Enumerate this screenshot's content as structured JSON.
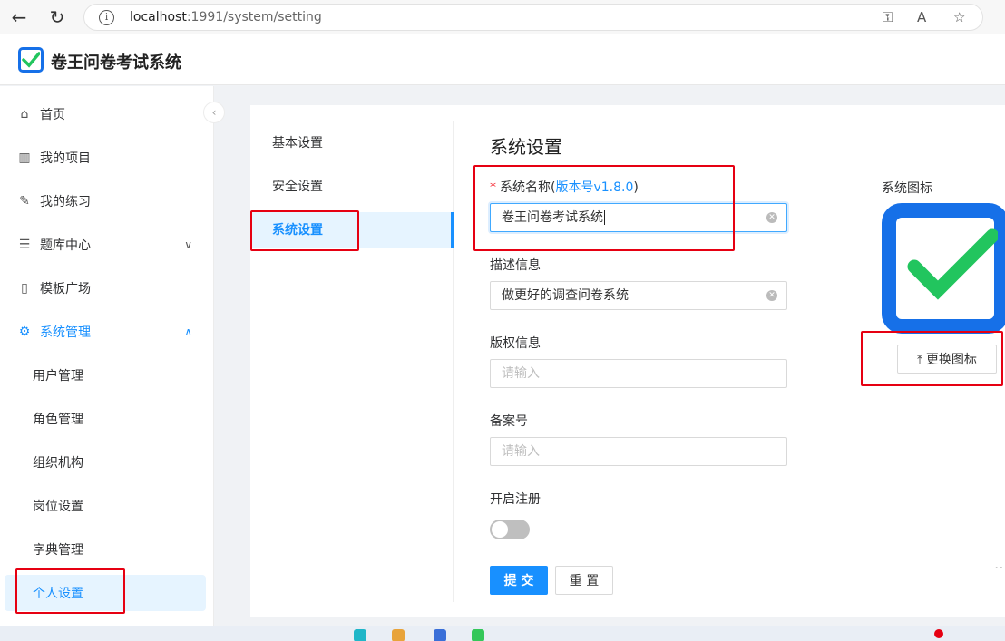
{
  "browser": {
    "url_host": "localhost",
    "url_rest": ":1991/system/setting"
  },
  "app": {
    "title": "卷王问卷考试系统"
  },
  "sidebar": {
    "items": [
      {
        "label": "首页",
        "icon": "home-icon"
      },
      {
        "label": "我的项目",
        "icon": "project-icon"
      },
      {
        "label": "我的练习",
        "icon": "edit-icon"
      },
      {
        "label": "题库中心",
        "icon": "database-icon"
      },
      {
        "label": "模板广场",
        "icon": "template-icon"
      },
      {
        "label": "系统管理",
        "icon": "gear-icon"
      },
      {
        "label": "用户管理"
      },
      {
        "label": "角色管理"
      },
      {
        "label": "组织机构"
      },
      {
        "label": "岗位设置"
      },
      {
        "label": "字典管理"
      },
      {
        "label": "个人设置"
      }
    ]
  },
  "tabs": [
    {
      "label": "基本设置"
    },
    {
      "label": "安全设置"
    },
    {
      "label": "系统设置"
    }
  ],
  "form": {
    "title": "系统设置",
    "name_label": "系统名称(",
    "name_version": "版本号v1.8.0",
    "name_label_end": ")",
    "name_value": "卷王问卷考试系统",
    "desc_label": "描述信息",
    "desc_value": "做更好的调查问卷系统",
    "copyright_label": "版权信息",
    "copyright_placeholder": "请输入",
    "icp_label": "备案号",
    "icp_placeholder": "请输入",
    "register_label": "开启注册",
    "register_enabled": false,
    "submit_label": "提 交",
    "reset_label": "重 置",
    "icon_label": "系统图标",
    "change_icon_label": "更换图标"
  },
  "colors": {
    "accent": "#1890ff",
    "logo_blue": "#1670e8",
    "logo_green": "#22c55e",
    "annotation": "#e60012"
  }
}
